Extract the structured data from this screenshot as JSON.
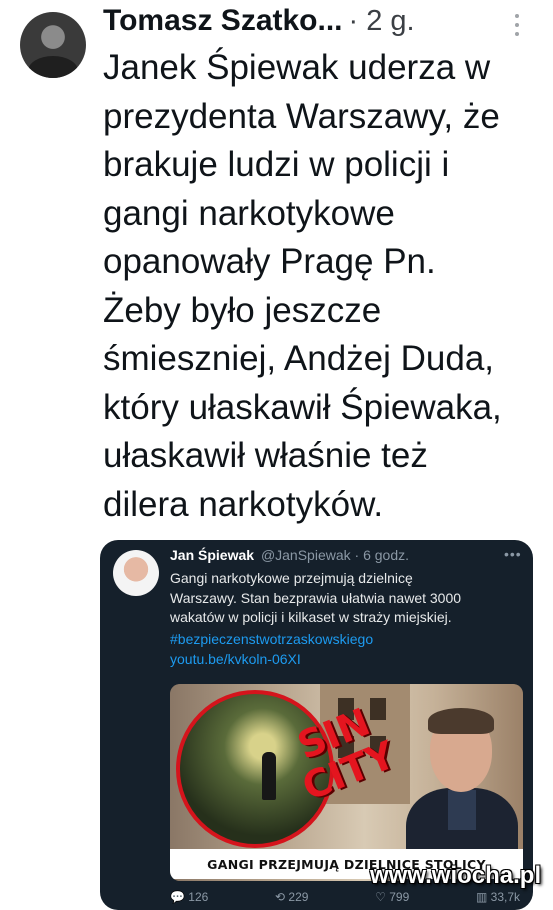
{
  "post": {
    "author_name": "Tomasz Szatko...",
    "meta": "· 2 g.",
    "text": "Janek Śpiewak uderza w\nprezydenta Warszawy, że\nbrakuje ludzi w policji i\ngangi narkotykowe\nopanowały Pragę Pn.\nŻeby było jeszcze\nśmieszniej, Andżej Duda,\nktóry ułaskawił Śpiewaka,\nułaskawił właśnie też\ndilera narkotyków.",
    "more_icon": "more-vertical-icon"
  },
  "quoted": {
    "name": "Jan Śpiewak",
    "meta": "@JanSpiewak · 6 godz.",
    "more_icon": "more-horizontal-icon",
    "text": "Gangi narkotykowe przejmują dzielnicę\nWarszawy. Stan bezprawia ułatwia nawet 3000\nwakatów w policji i kilkaset w straży miejskiej.",
    "hashtag": "#bezpieczenstwotrzaskowskiego",
    "link": "youtu.be/kvkoln-06XI",
    "image_text_line1": "SIN",
    "image_text_line2": "CITY",
    "banner": "GANGI PRZEJMUJĄ DZIELNICE STOLICY",
    "actions": {
      "reply_count": "126",
      "retweet_count": "229",
      "like_count": "799",
      "views_count": "33,7k"
    }
  },
  "watermark": "www.wiocha.pl",
  "colors": {
    "accent": "#1d9bf0",
    "card_bg": "#15202b",
    "sin_red": "#e4151f"
  }
}
